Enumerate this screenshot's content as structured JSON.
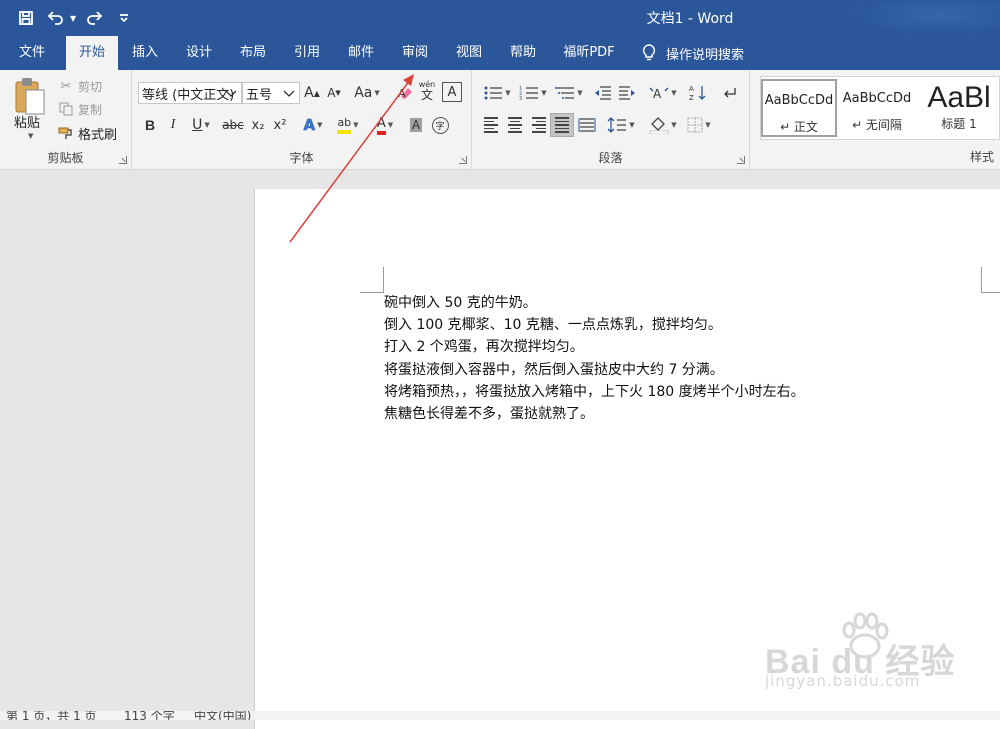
{
  "title_bar": {
    "document_title": "文档1  -  Word",
    "quick_access": [
      "save-icon",
      "undo-icon",
      "redo-icon",
      "customize-icon"
    ]
  },
  "tabs": {
    "file": "文件",
    "home": "开始",
    "insert": "插入",
    "design": "设计",
    "layout": "布局",
    "references": "引用",
    "mailings": "邮件",
    "review": "审阅",
    "view": "视图",
    "help": "帮助",
    "foxit": "福昕PDF",
    "tell_me": "操作说明搜索"
  },
  "ribbon": {
    "clipboard": {
      "label": "剪贴板",
      "paste": "粘贴",
      "cut": "剪切",
      "copy": "复制",
      "format_painter": "格式刷"
    },
    "font": {
      "label": "字体",
      "font_name": "等线 (中文正文)",
      "font_size": "五号",
      "change_case": "Aa",
      "phonetic": "wén",
      "phonetic_char": "文",
      "border_char": "A",
      "bold": "B",
      "italic": "I",
      "underline": "U",
      "strike": "abc",
      "subscript": "x₂",
      "superscript": "x²",
      "shading_char": "A",
      "enclose_char": "字"
    },
    "paragraph": {
      "label": "段落"
    },
    "styles": {
      "label": "样式",
      "items": [
        {
          "preview": "AaBbCcDd",
          "name": "↵ 正文"
        },
        {
          "preview": "AaBbCcDd",
          "name": "↵ 无间隔"
        },
        {
          "preview": "AaBl",
          "name": "标题 1"
        }
      ]
    }
  },
  "document": {
    "paragraphs": [
      "碗中倒入 50 克的牛奶。",
      "倒入 100 克椰浆、10 克糖、一点点炼乳，搅拌均匀。",
      "打入 2 个鸡蛋，再次搅拌均匀。",
      "将蛋挞液倒入容器中，然后倒入蛋挞皮中大约 7 分满。",
      "将烤箱预热，，将蛋挞放入烤箱中，上下火 180 度烤半个小时左右。",
      "焦糖色长得差不多，蛋挞就熟了。"
    ]
  },
  "status_bar": {
    "page": "第 1 页，共 1 页",
    "words": "113 个字",
    "language": "中文(中国)"
  },
  "watermark": {
    "main": "Bai du 经验",
    "sub": "jingyan.baidu.com"
  },
  "colors": {
    "word_blue": "#2b579a",
    "ribbon_bg": "#f3f3f3",
    "annotation_arrow": "#e0403a"
  }
}
